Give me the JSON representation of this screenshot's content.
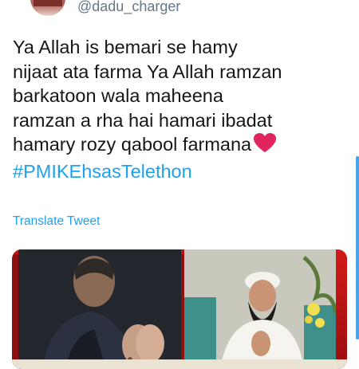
{
  "user": {
    "handle": "@dadu_charger"
  },
  "tweet": {
    "lines": [
      "Ya Allah is bemari se hamy",
      "nijaat ata farma Ya Allah ramzan",
      "barkatoon wala maheena",
      "ramzan a rha hai hamari ibadat",
      "hamary rozy qabool farmana"
    ],
    "hashtag": "#PMIKEhsasTelethon",
    "translate_label": "Translate Tweet"
  },
  "media": {
    "left_icon": "man-praying-image",
    "right_icon": "cleric-praying-image"
  },
  "colors": {
    "link": "#1da1f2",
    "text": "#14171a",
    "muted": "#657786",
    "heart": "#e0245e"
  }
}
